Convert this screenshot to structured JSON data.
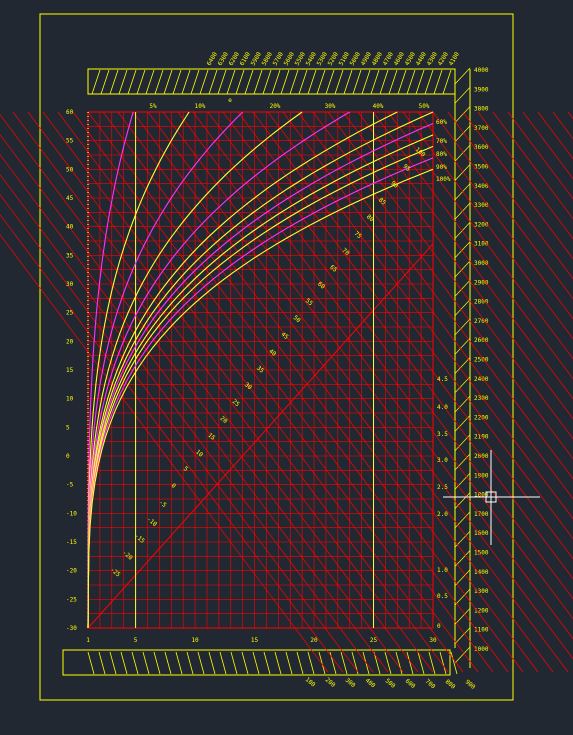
{
  "viewport": {
    "background": "#222831"
  },
  "colors": {
    "frame": "#ffff00",
    "grid": "#ff0000",
    "curve_yellow": "#ffff33",
    "curve_magenta": "#ff33ff",
    "crosshair": "#ffffff"
  },
  "chart_data": {
    "type": "line",
    "title": "",
    "x_axis": {
      "ticks": [
        "1",
        "5",
        "10",
        "15",
        "20",
        "25",
        "30"
      ],
      "range": [
        1,
        30
      ]
    },
    "y_axis": {
      "ticks": [
        "60",
        "55",
        "50",
        "45",
        "40",
        "35",
        "30",
        "25",
        "20",
        "15",
        "10",
        "5",
        "0",
        "-5",
        "-10",
        "-15",
        "-20",
        "-25",
        "-30"
      ],
      "range": [
        -30,
        60
      ]
    },
    "top_percent_labels": [
      "5%",
      "10%",
      "20%",
      "30%",
      "40%",
      "50%"
    ],
    "rh_labels": [
      "60%",
      "70%",
      "80%",
      "90%",
      "100%"
    ],
    "right_inner_scale": [
      "4.5",
      "4.0",
      "3.5",
      "3.0",
      "2.5",
      "2.0",
      "1.0",
      "0.5",
      "0"
    ],
    "right_outer_scale": [
      "4000",
      "3900",
      "3800",
      "3700",
      "3600",
      "3500",
      "3400",
      "3300",
      "3200",
      "3100",
      "3000",
      "2900",
      "2800",
      "2700",
      "2600",
      "2500",
      "2400",
      "2300",
      "2200",
      "2100",
      "2000",
      "1900",
      "1800",
      "1700",
      "1600",
      "1500",
      "1400",
      "1300",
      "1200",
      "1100",
      "1000"
    ],
    "top_diag_labels": [
      "6400",
      "6300",
      "6200",
      "6100",
      "5900",
      "5800",
      "5700",
      "5600",
      "5500",
      "5400",
      "5300",
      "5200",
      "5100",
      "5000",
      "4900",
      "4800",
      "4700",
      "4600",
      "4500",
      "4400",
      "4300",
      "4200",
      "4100"
    ],
    "top_mid_label": "e",
    "bottom_diag_labels": [
      "100",
      "200",
      "300",
      "400",
      "500",
      "600",
      "700",
      "800",
      "900"
    ],
    "enthalpy_labels": [
      "-25",
      "-20",
      "-15",
      "-10",
      "-5",
      "0",
      "5",
      "10",
      "15",
      "20",
      "25",
      "30",
      "35",
      "40",
      "45",
      "50",
      "55",
      "60",
      "65",
      "70",
      "75",
      "80",
      "85",
      "90",
      "95",
      "100"
    ]
  },
  "cursor_icon": "crosshair-cursor-icon"
}
